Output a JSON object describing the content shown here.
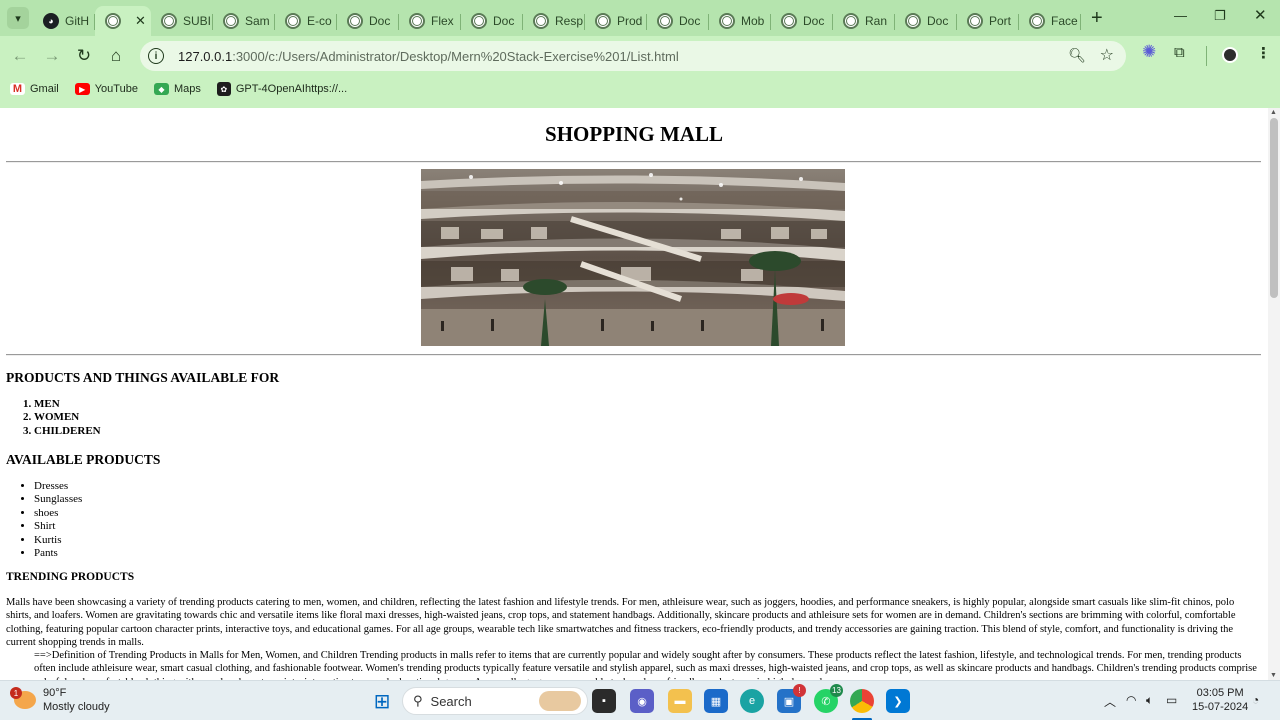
{
  "browser": {
    "tabs": [
      {
        "title": "GitH",
        "icon": "github-icon"
      },
      {
        "title": "",
        "icon": "globe-icon",
        "active": true
      },
      {
        "title": "SUBI",
        "icon": "globe-icon"
      },
      {
        "title": "Sam",
        "icon": "globe-icon"
      },
      {
        "title": "E-co",
        "icon": "globe-icon"
      },
      {
        "title": "Doc",
        "icon": "globe-icon"
      },
      {
        "title": "Flex",
        "icon": "globe-icon"
      },
      {
        "title": "Doc",
        "icon": "globe-icon"
      },
      {
        "title": "Resp",
        "icon": "globe-icon"
      },
      {
        "title": "Prod",
        "icon": "globe-icon"
      },
      {
        "title": "Doc",
        "icon": "globe-icon"
      },
      {
        "title": "Mob",
        "icon": "globe-icon"
      },
      {
        "title": "Doc",
        "icon": "globe-icon"
      },
      {
        "title": "Ran",
        "icon": "globe-icon"
      },
      {
        "title": "Doc",
        "icon": "globe-icon"
      },
      {
        "title": "Port",
        "icon": "globe-icon"
      },
      {
        "title": "Face",
        "icon": "globe-icon"
      }
    ],
    "url_host": "127.0.0.1",
    "url_rest": ":3000/c:/Users/Administrator/Desktop/Mern%20Stack-Exercise%201/List.html",
    "bookmarks": [
      {
        "label": "Gmail",
        "icon": "gmail-icon"
      },
      {
        "label": "YouTube",
        "icon": "youtube-icon"
      },
      {
        "label": "Maps",
        "icon": "maps-icon"
      },
      {
        "label": "GPT-4OpenAIhttps://...",
        "icon": "openai-icon"
      }
    ],
    "theme_color": "#b5e4ae"
  },
  "page": {
    "title": "SHOPPING MALL",
    "section1_heading": "PRODUCTS AND THINGS AVAILABLE FOR",
    "audience": [
      "MEN",
      "WOMEN",
      "CHILDEREN"
    ],
    "section2_heading": "AVAILABLE PRODUCTS",
    "products": [
      "Dresses",
      "Sunglasses",
      "shoes",
      "Shirt",
      "Kurtis",
      "Pants"
    ],
    "section3_heading": "TRENDING PRODUCTS",
    "paragraph": "Malls have been showcasing a variety of trending products catering to men, women, and children, reflecting the latest fashion and lifestyle trends. For men, athleisure wear, such as joggers, hoodies, and performance sneakers, is highly popular, alongside smart casuals like slim-fit chinos, polo shirts, and loafers. Women are gravitating towards chic and versatile items like floral maxi dresses, high-waisted jeans, crop tops, and statement handbags. Additionally, skincare products and athleisure sets for women are in demand. Children's sections are brimming with colorful, comfortable clothing, featuring popular cartoon character prints, interactive toys, and educational games. For all age groups, wearable tech like smartwatches and fitness trackers, eco-friendly products, and trendy accessories are gaining traction. This blend of style, comfort, and functionality is driving the current shopping trends in malls.",
    "paragraph2": "==>Definition of Trending Products in Malls for Men, Women, and Children Trending products in malls refer to items that are currently popular and widely sought after by consumers. These products reflect the latest fashion, lifestyle, and technological trends. For men, trending products often include athleisure wear, smart casual clothing, and fashionable footwear. Women's trending products typically feature versatile and stylish apparel, such as maxi dresses, high-waisted jeans, and crop tops, as well as skincare products and handbags. Children's trending products comprise colorful and comfortable clothing with popular character prints, interactive toys, and educational games. Across all age groups, wearable tech and eco-friendly products are in high demand."
  },
  "taskbar": {
    "weather_temp": "90°F",
    "weather_desc": "Mostly cloudy",
    "weather_badge": "1",
    "search_label": "Search",
    "time": "03:05 PM",
    "date": "15-07-2024",
    "whatsapp_badge": "13",
    "store_badge": "!"
  }
}
